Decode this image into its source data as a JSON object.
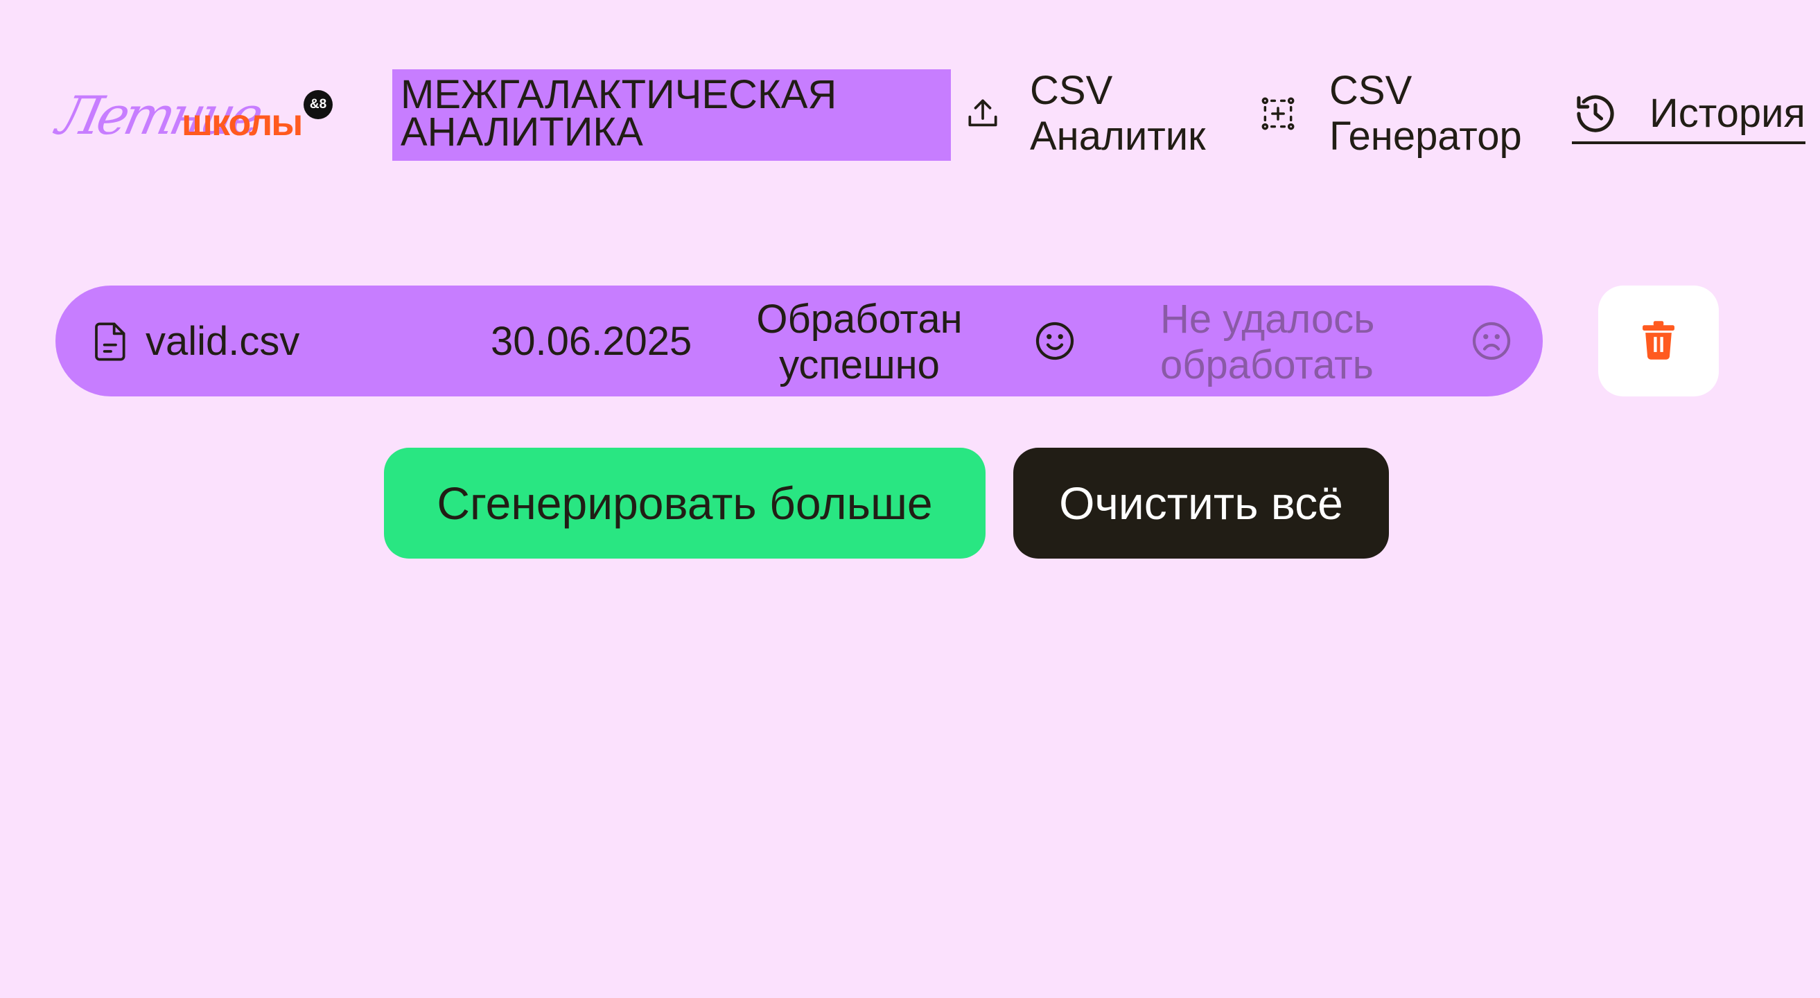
{
  "logo": {
    "script_text": "Летние",
    "bold_text": "школы",
    "badge_text": "&8"
  },
  "header": {
    "brand_title_line1": "МЕЖГАЛАКТИЧЕСКАЯ",
    "brand_title_line2": "АНАЛИТИКА",
    "nav": {
      "csv_analyst": {
        "line1": "CSV",
        "line2": "Аналитик",
        "icon": "upload-icon"
      },
      "csv_generator": {
        "line1": "CSV",
        "line2": "Генератор",
        "icon": "scan-plus-icon"
      },
      "history": {
        "label": "История",
        "icon": "history-clock-icon"
      }
    }
  },
  "history_items": [
    {
      "file_name": "valid.csv",
      "date": "30.06.2025",
      "success_label_line1": "Обработан",
      "success_label_line2": "успешно",
      "failed_label_line1": "Не удалось",
      "failed_label_line2": "обработать",
      "success_icon": "smile-icon",
      "failed_icon": "sad-face-icon",
      "delete_icon": "trash-icon"
    }
  ],
  "actions": {
    "generate_more_label": "Сгенерировать больше",
    "clear_all_label": "Очистить всё"
  },
  "colors": {
    "background": "#fbe1fd",
    "accent_purple": "#c77dff",
    "accent_green": "#29e682",
    "dark": "#211d15",
    "danger_orange": "#ff5a1f",
    "muted_text": "#8a5aa6"
  }
}
